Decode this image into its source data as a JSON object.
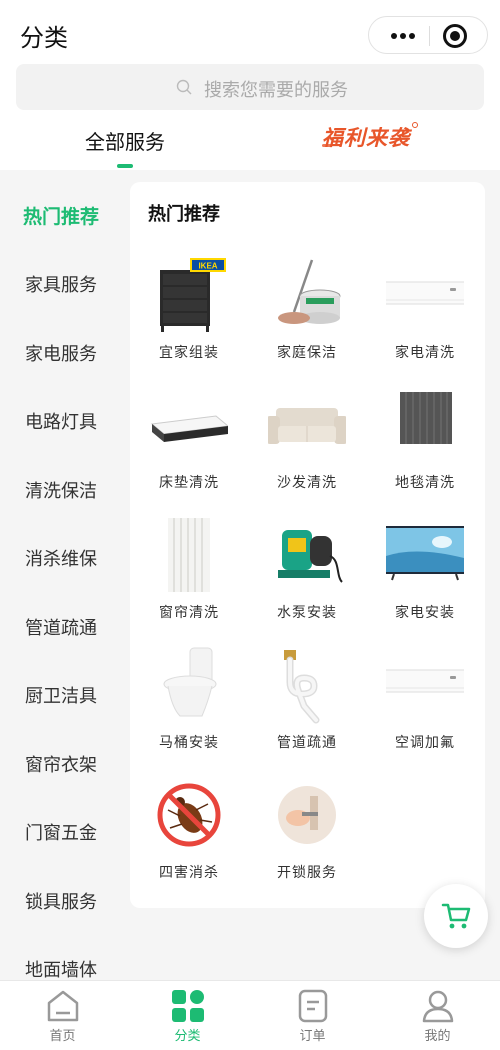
{
  "header": {
    "title": "分类",
    "more_icon": "ellipsis-icon",
    "close_icon": "target-icon"
  },
  "search": {
    "placeholder": "搜索您需要的服务",
    "icon": "search-icon"
  },
  "tabs": {
    "all": "全部服务",
    "welfare": "福利来袭",
    "active": "all"
  },
  "sidebar": {
    "active_index": 0,
    "items": [
      "热门推荐",
      "家具服务",
      "家电服务",
      "电路灯具",
      "清洗保洁",
      "消杀维保",
      "管道疏通",
      "厨卫洁具",
      "窗帘衣架",
      "门窗五金",
      "锁具服务",
      "地面墙体"
    ]
  },
  "panel": {
    "title": "热门推荐",
    "services": [
      {
        "label": "宜家组装",
        "icon": "ikea-dresser-icon",
        "badge": "IKEA"
      },
      {
        "label": "家庭保洁",
        "icon": "mop-bucket-icon"
      },
      {
        "label": "家电清洗",
        "icon": "air-conditioner-icon"
      },
      {
        "label": "床垫清洗",
        "icon": "mattress-icon"
      },
      {
        "label": "沙发清洗",
        "icon": "sofa-icon"
      },
      {
        "label": "地毯清洗",
        "icon": "carpet-icon"
      },
      {
        "label": "窗帘清洗",
        "icon": "curtain-icon"
      },
      {
        "label": "水泵安装",
        "icon": "water-pump-icon"
      },
      {
        "label": "家电安装",
        "icon": "television-icon"
      },
      {
        "label": "马桶安装",
        "icon": "toilet-icon"
      },
      {
        "label": "管道疏通",
        "icon": "drain-pipe-icon"
      },
      {
        "label": "空调加氟",
        "icon": "air-conditioner-icon"
      },
      {
        "label": "四害消杀",
        "icon": "no-pest-icon"
      },
      {
        "label": "开锁服务",
        "icon": "door-lock-icon"
      }
    ]
  },
  "cart": {
    "icon": "shopping-cart-icon"
  },
  "bottom_nav": {
    "active_index": 1,
    "items": [
      {
        "label": "首页",
        "icon": "home-icon"
      },
      {
        "label": "分类",
        "icon": "category-icon"
      },
      {
        "label": "订单",
        "icon": "order-icon"
      },
      {
        "label": "我的",
        "icon": "profile-icon"
      }
    ]
  },
  "colors": {
    "accent": "#1dbb73",
    "welfare": "#e8562a",
    "background": "#f5f5f5"
  }
}
